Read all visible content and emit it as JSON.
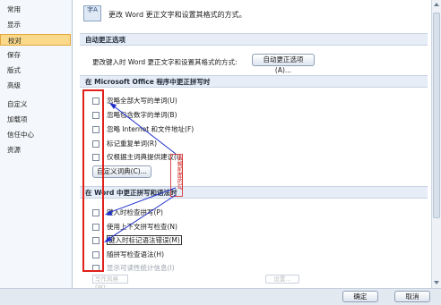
{
  "sidebar": {
    "items": [
      {
        "label": "常用"
      },
      {
        "label": "显示"
      },
      {
        "label": "校对"
      },
      {
        "label": "保存"
      },
      {
        "label": "版式"
      },
      {
        "label": "高级"
      },
      {
        "label": "自定义"
      },
      {
        "label": "加载项"
      },
      {
        "label": "信任中心"
      },
      {
        "label": "资源"
      }
    ],
    "active_index": 2
  },
  "header": {
    "icon_text": "字A",
    "title": "更改 Word 更正文字和设置其格式的方式。"
  },
  "autocorrect_section": {
    "title": "自动更正选项",
    "label": "更改键入时 Word 更正文字和设置其格式的方式:",
    "button": "自动更正选项(A)..."
  },
  "office_section": {
    "title": "在 Microsoft Office 程序中更正拼写时",
    "options": [
      {
        "label": "忽略全部大写的单词(U)",
        "checked": false
      },
      {
        "label": "忽略包含数字的单词(B)",
        "checked": false
      },
      {
        "label": "忽略 Internet 和文件地址(F)",
        "checked": false
      },
      {
        "label": "标记重复单词(R)",
        "checked": false
      },
      {
        "label": "仅根据主词典提供建议(I)",
        "checked": false
      }
    ],
    "custom_dict_button": "自定义词典(C)..."
  },
  "word_section": {
    "title": "在 Word 中更正拼写和语法时",
    "options": [
      {
        "label": "键入时检查拼写(P)",
        "checked": false
      },
      {
        "label": "使用上下文拼写检查(N)",
        "checked": false
      },
      {
        "label": "键入时标记语法错误(M)",
        "checked": false
      },
      {
        "label": "随拼写检查语法(H)",
        "checked": false
      },
      {
        "label": "显示可读性统计信息(I)",
        "checked": false,
        "dim": true
      }
    ]
  },
  "annotation": {
    "text": "去掉前面的勾"
  },
  "bottom": {
    "dict_field": "写作风格(W):",
    "settings_button": "设置...",
    "ok": "确定",
    "cancel": "取消"
  },
  "colors": {
    "annotation_red": "#e0201b",
    "arrow_blue": "#1f2fc9",
    "active_tab": "#fbd98a"
  }
}
